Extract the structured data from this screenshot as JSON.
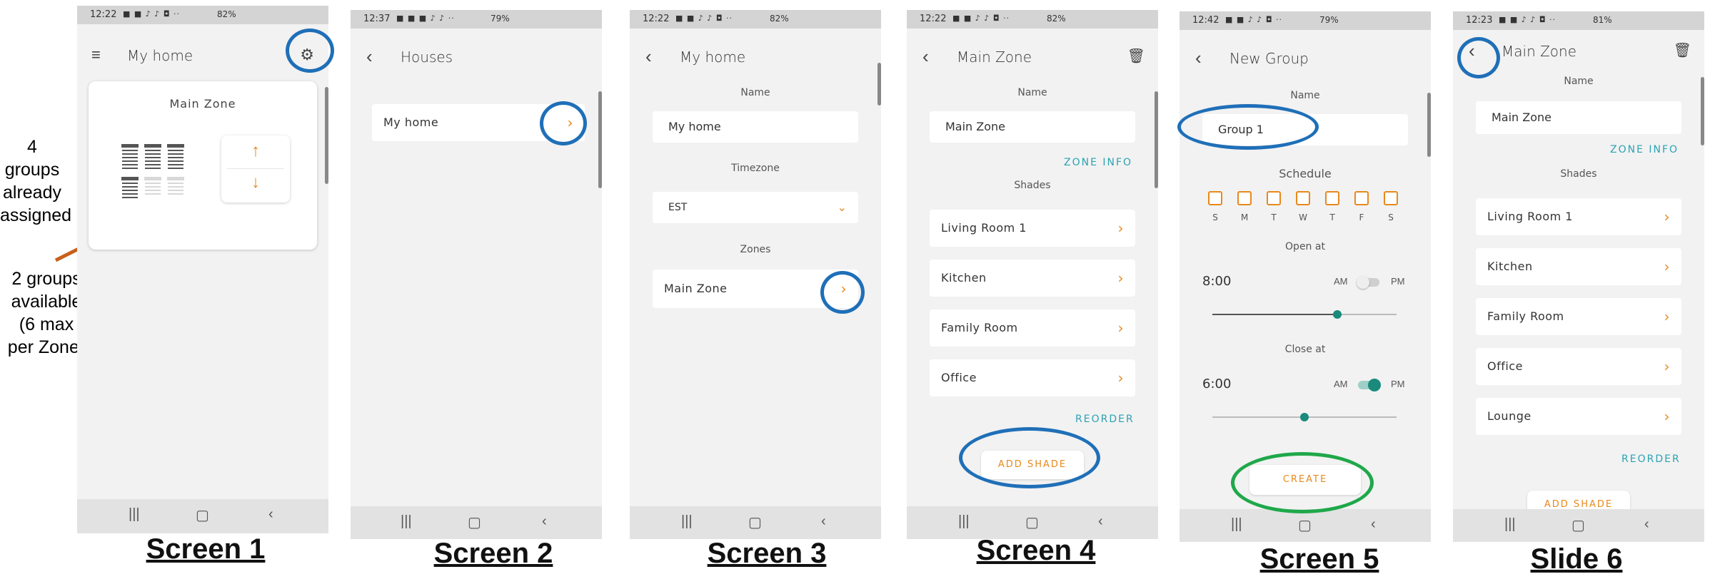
{
  "annotations": {
    "groups_assigned": [
      "4 groups",
      "already",
      "assigned"
    ],
    "groups_available": [
      "2 groups",
      "available",
      "(6 max",
      "per Zone)"
    ]
  },
  "captions": [
    "Screen 1",
    "Screen 2",
    "Screen 3",
    "Screen 4",
    "Screen 5",
    "Slide 6"
  ],
  "screen1": {
    "status_time": "12:22",
    "status_batt": "82%",
    "title": "My home",
    "card_title": "Main Zone"
  },
  "screen2": {
    "status_time": "12:37",
    "status_batt": "79%",
    "title": "Houses",
    "house": "My home"
  },
  "screen3": {
    "status_time": "12:22",
    "status_batt": "82%",
    "title": "My home",
    "name_label": "Name",
    "name_value": "My home",
    "timezone_label": "Timezone",
    "timezone_value": "EST",
    "zones_label": "Zones",
    "zone": "Main Zone"
  },
  "screen4": {
    "status_time": "12:22",
    "status_batt": "82%",
    "title": "Main Zone",
    "name_label": "Name",
    "name_value": "Main Zone",
    "zone_info": "ZONE INFO",
    "shades_label": "Shades",
    "shades": [
      "Living Room 1",
      "Kitchen",
      "Family Room",
      "Office"
    ],
    "reorder": "REORDER",
    "add_shade": "ADD SHADE"
  },
  "screen5": {
    "status_time": "12:42",
    "status_batt": "79%",
    "title": "New Group",
    "name_label": "Name",
    "name_value": "Group 1",
    "schedule_label": "Schedule",
    "days": [
      "S",
      "M",
      "T",
      "W",
      "T",
      "F",
      "S"
    ],
    "open_label": "Open at",
    "open_time": "8:00",
    "close_label": "Close at",
    "close_time": "6:00",
    "am": "AM",
    "pm": "PM",
    "create": "CREATE",
    "open_slider": 0.68,
    "close_slider": 0.5
  },
  "screen6": {
    "status_time": "12:23",
    "status_batt": "81%",
    "title": "Main Zone",
    "name_label": "Name",
    "name_value": "Main Zone",
    "zone_info": "ZONE INFO",
    "shades_label": "Shades",
    "shades": [
      "Living Room 1",
      "Kitchen",
      "Family Room",
      "Office",
      "Lounge"
    ],
    "reorder": "REORDER",
    "add_shade": "ADD SHADE"
  },
  "colors": {
    "accent": "#e8891c",
    "teal": "#2ba3b3",
    "ring_blue": "#1f6fb8",
    "ring_green": "#1fa84a",
    "arrow": "#c8601a"
  }
}
